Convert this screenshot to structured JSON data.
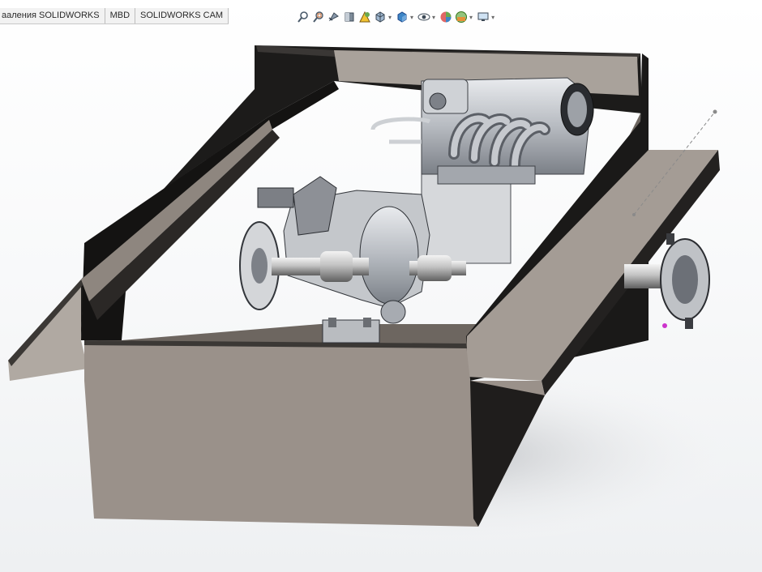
{
  "app": {
    "name": "SOLIDWORKS"
  },
  "tabs": [
    {
      "label": "ааления SOLIDWORKS"
    },
    {
      "label": "MBD"
    },
    {
      "label": "SOLIDWORKS CAM"
    }
  ],
  "heads_up_toolbar": {
    "icons": [
      "zoom-to-fit-icon",
      "zoom-to-area-icon",
      "previous-view-icon",
      "section-view-icon",
      "dynamic-annotation-views-icon",
      "view-orientation-icon",
      "display-style-icon",
      "hide-show-items-icon",
      "edit-appearance-icon",
      "apply-scene-icon",
      "view-settings-icon"
    ]
  },
  "colors": {
    "frame_top": "#a79e95",
    "frame_dark": "#1c1b1a",
    "frame_front": "#9a918a",
    "floor": "#6d6660",
    "engine_metal": "#c9ccd0",
    "selection_magenta": "#cc33cc"
  }
}
